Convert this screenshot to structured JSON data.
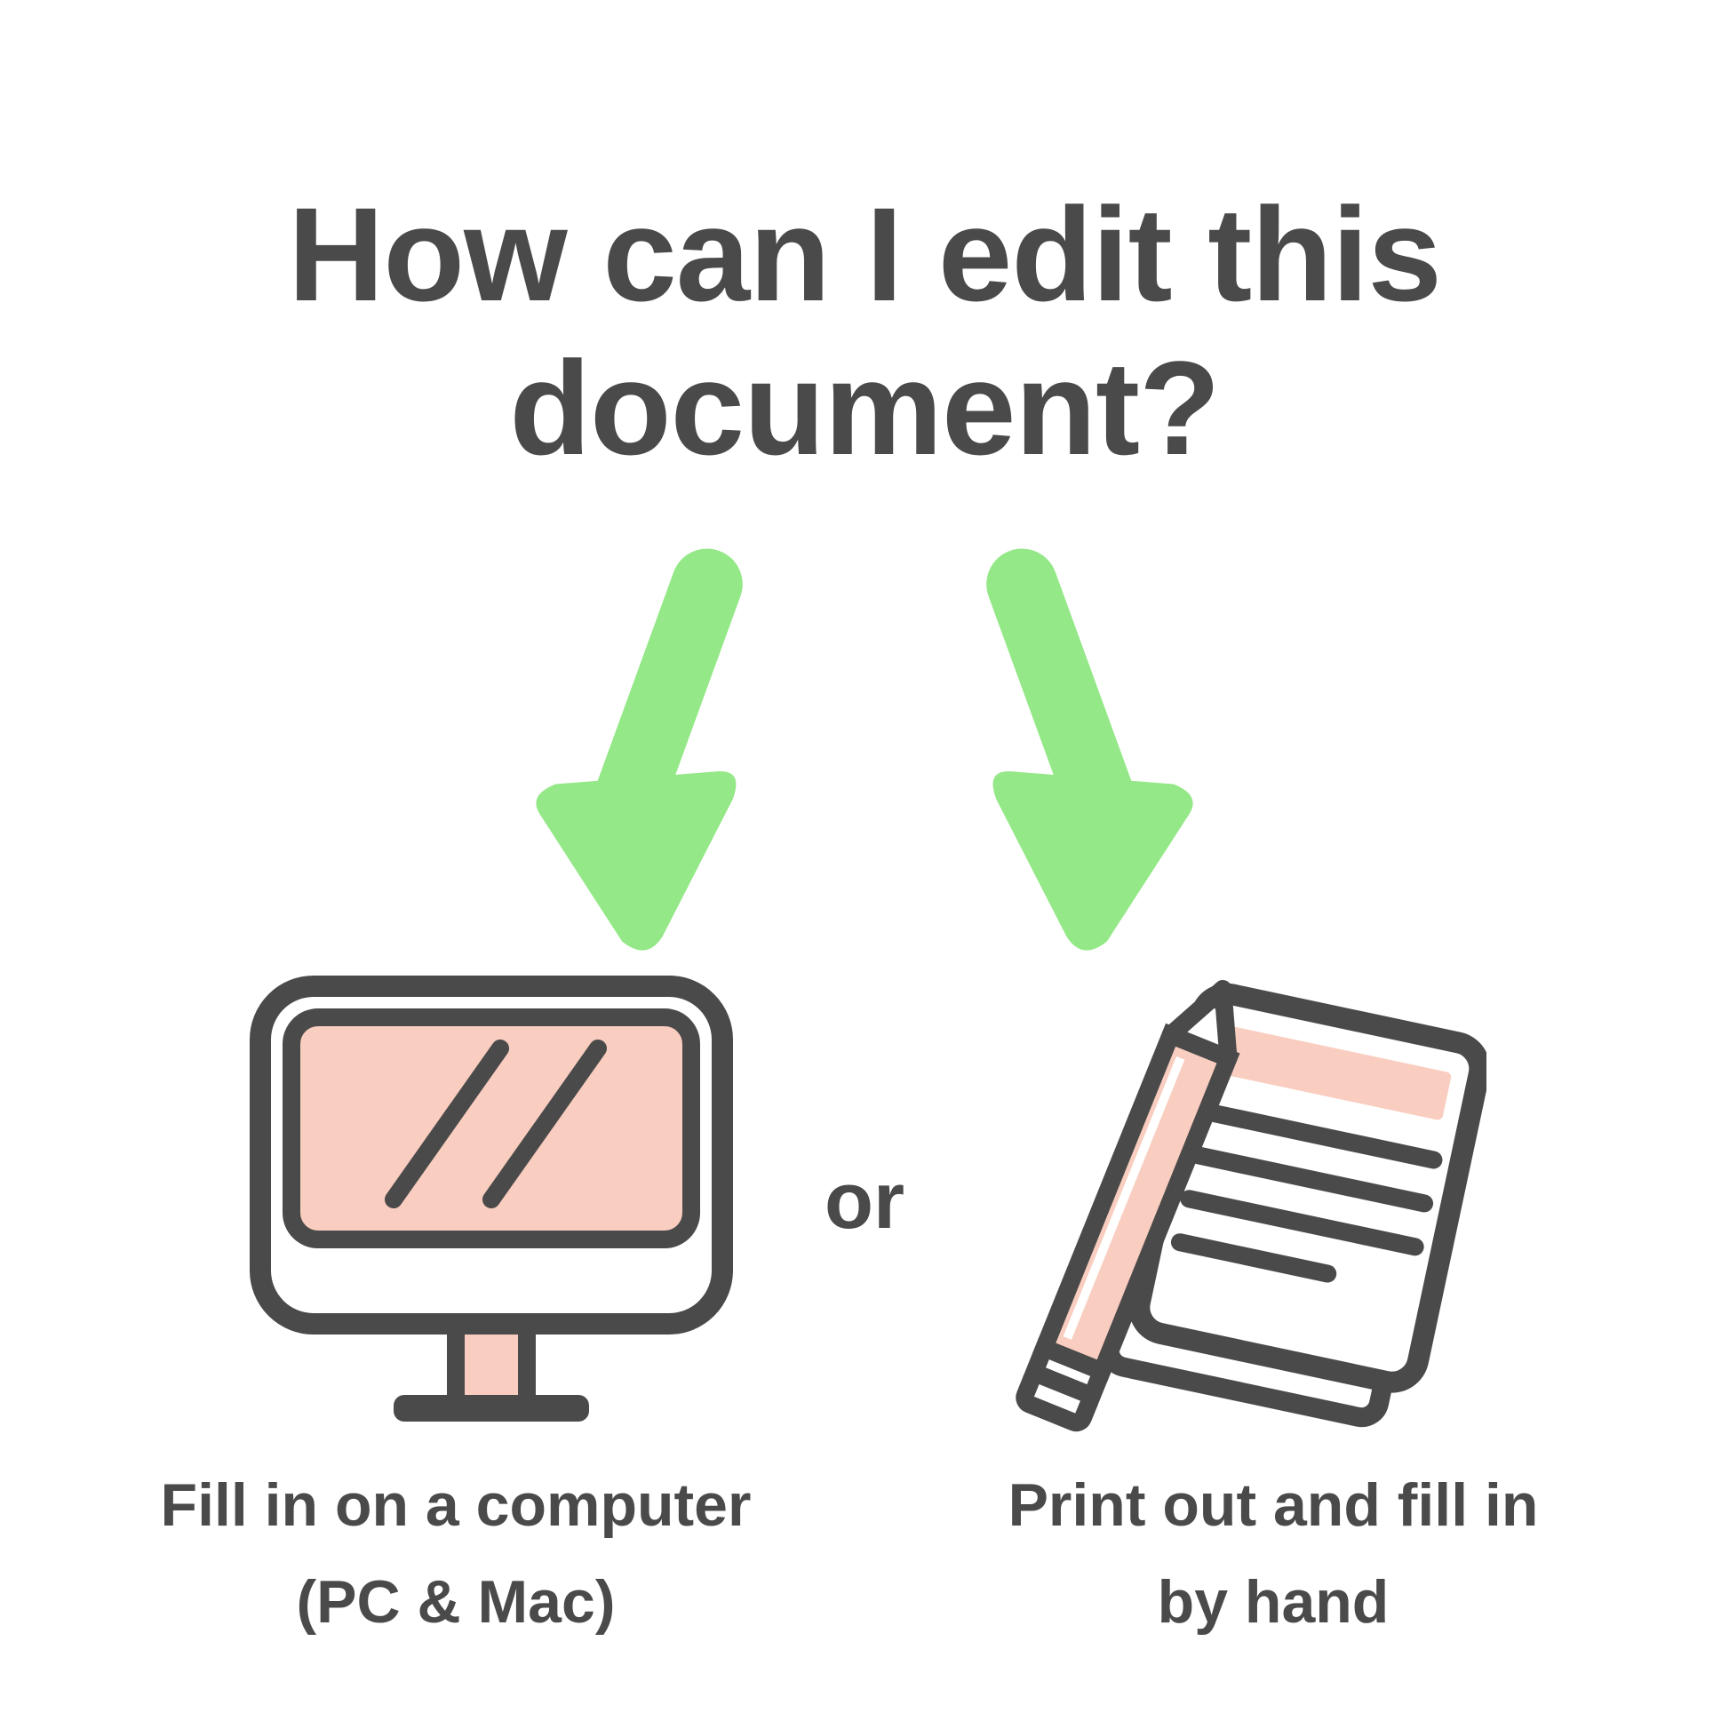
{
  "title": "How can I edit this document?",
  "separator": "or",
  "options": {
    "left": {
      "caption_line1": "Fill in on a computer",
      "caption_line2": "(PC & Mac)"
    },
    "right": {
      "caption_line1": "Print out and fill in",
      "caption_line2": "by hand"
    }
  },
  "colors": {
    "stroke": "#4a4a4a",
    "peach": "#f9cdbf",
    "green": "#94e887",
    "white": "#ffffff"
  }
}
